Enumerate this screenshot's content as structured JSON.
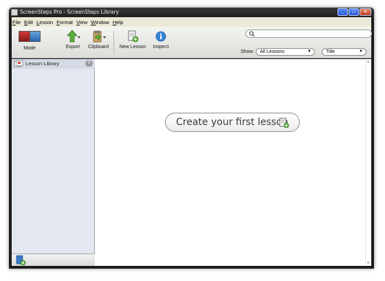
{
  "window": {
    "title": "ScreenSteps Pro - ScreenSteps Library",
    "controls": {
      "minimize": "_",
      "maximize": "□",
      "close": "×"
    }
  },
  "menubar": {
    "items": [
      "File",
      "Edit",
      "Lesson",
      "Format",
      "View",
      "Window",
      "Help"
    ]
  },
  "toolbar": {
    "mode_label": "Mode",
    "export_label": "Export",
    "clipboard_label": "Clipboard",
    "new_lesson_label": "New Lesson",
    "inspect_label": "Inspect",
    "search_placeholder": "",
    "show_label": "Show:",
    "show_filter_value": "All Lessons",
    "sort_value": "Title"
  },
  "sidebar": {
    "library_label": "Lesson Library",
    "library_count": "0"
  },
  "main": {
    "create_prompt": "Create your first lesson"
  },
  "colors": {
    "sidebar_bg": "#e2e7f0",
    "titlebar_bg": "#1e1e1e",
    "accent_blue": "#2466b0"
  }
}
